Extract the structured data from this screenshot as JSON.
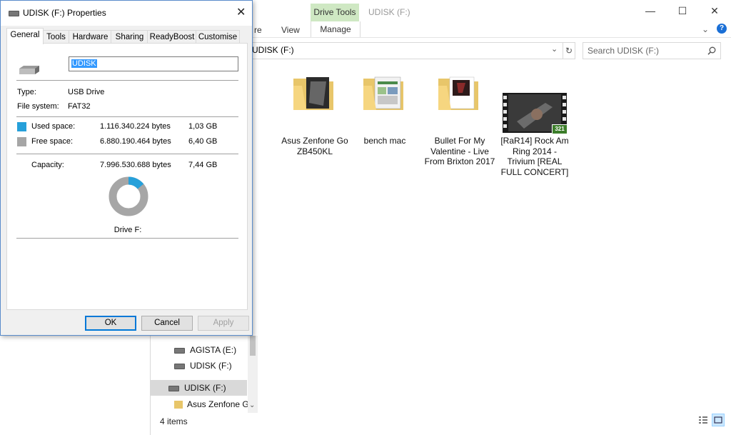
{
  "explorer": {
    "ribbon": {
      "context_group": "Drive Tools",
      "title": "UDISK (F:)",
      "tabs": [
        "re",
        "View",
        "Manage"
      ]
    },
    "address": "UDISK (F:)",
    "search_placeholder": "Search UDISK (F:)",
    "files": [
      {
        "name": "Asus Zenfone Go ZB450KL",
        "kind": "folder"
      },
      {
        "name": "bench mac",
        "kind": "folder"
      },
      {
        "name": "Bullet For My Valentine - Live From Brixton 2017",
        "kind": "folder"
      },
      {
        "name": "[RaR14] Rock Am Ring 2014 - Trivium [REAL FULL CONCERT]",
        "kind": "video",
        "badge": "321"
      }
    ],
    "nav": [
      "AGISTA (E:)",
      "UDISK (F:)",
      "UDISK (F:)",
      "Asus Zenfone Go"
    ],
    "status": "4 items"
  },
  "dialog": {
    "title": "UDISK (F:) Properties",
    "tabs": [
      "General",
      "Tools",
      "Hardware",
      "Sharing",
      "ReadyBoost",
      "Customise"
    ],
    "name_value": "UDISK",
    "type_label": "Type:",
    "type_value": "USB Drive",
    "fs_label": "File system:",
    "fs_value": "FAT32",
    "used_label": "Used space:",
    "used_bytes": "1.116.340.224 bytes",
    "used_gb": "1,03 GB",
    "free_label": "Free space:",
    "free_bytes": "6.880.190.464 bytes",
    "free_gb": "6,40 GB",
    "cap_label": "Capacity:",
    "cap_bytes": "7.996.530.688 bytes",
    "cap_gb": "7,44 GB",
    "drive_label": "Drive F:",
    "used_fraction": 0.1396,
    "colors": {
      "used": "#26a0da",
      "free": "#a6a6a6"
    },
    "ok": "OK",
    "cancel": "Cancel",
    "apply": "Apply"
  }
}
